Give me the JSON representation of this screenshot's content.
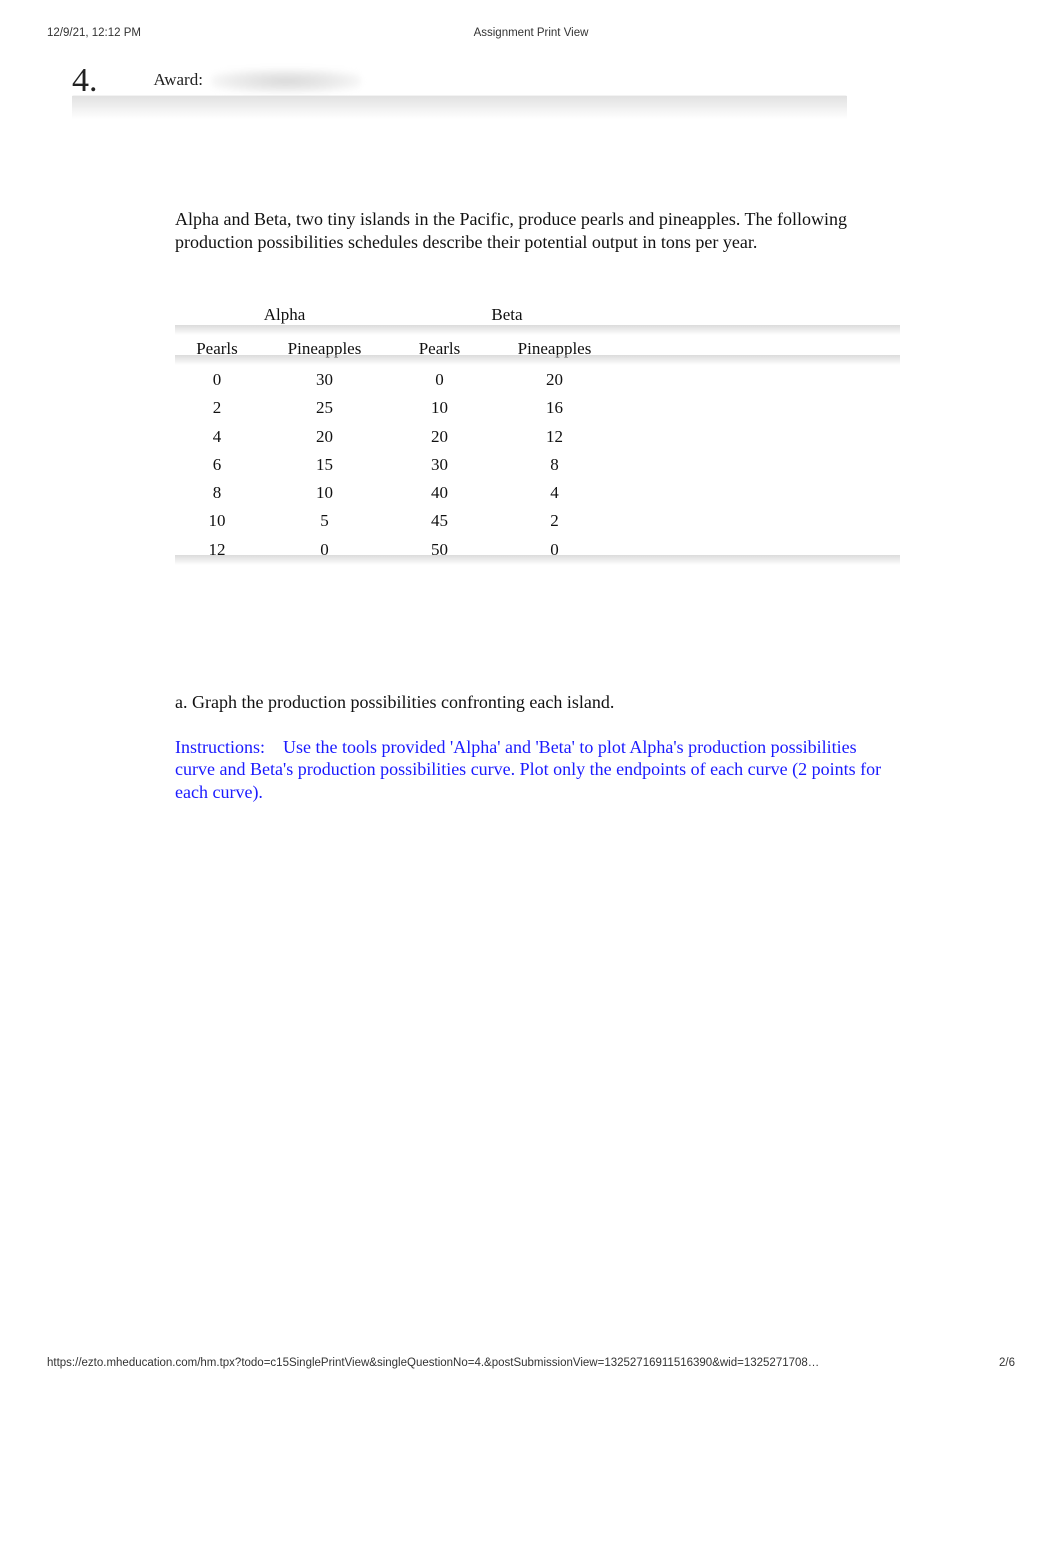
{
  "header": {
    "datetime": "12/9/21, 12:12 PM",
    "title": "Assignment Print View"
  },
  "question": {
    "number": "4.",
    "award_label": "Award:"
  },
  "intro": "Alpha and Beta, two tiny islands in the Pacific, produce pearls and pineapples. The following production possibilities schedules describe their potential output in tons per year.",
  "table": {
    "group_headers": [
      "Alpha",
      "Beta"
    ],
    "col_headers": [
      "Pearls",
      "Pineapples",
      "Pearls",
      "Pineapples"
    ],
    "rows": [
      [
        "0",
        "30",
        "0",
        "20"
      ],
      [
        "2",
        "25",
        "10",
        "16"
      ],
      [
        "4",
        "20",
        "20",
        "12"
      ],
      [
        "6",
        "15",
        "30",
        "8"
      ],
      [
        "8",
        "10",
        "40",
        "4"
      ],
      [
        "10",
        "5",
        "45",
        "2"
      ],
      [
        "12",
        "0",
        "50",
        "0"
      ]
    ]
  },
  "part_a": "a. Graph the production possibilities confronting each island.",
  "instructions": {
    "label": "Instructions:",
    "text": "Use the tools provided 'Alpha' and 'Beta' to plot Alpha's production possibilities curve and Beta's production possibilities curve. Plot only the endpoints of each curve (2 points for each curve)."
  },
  "footer": {
    "url": "https://ezto.mheducation.com/hm.tpx?todo=c15SinglePrintView&singleQuestionNo=4.&postSubmissionView=13252716911516390&wid=1325271708…",
    "page": "2/6"
  }
}
